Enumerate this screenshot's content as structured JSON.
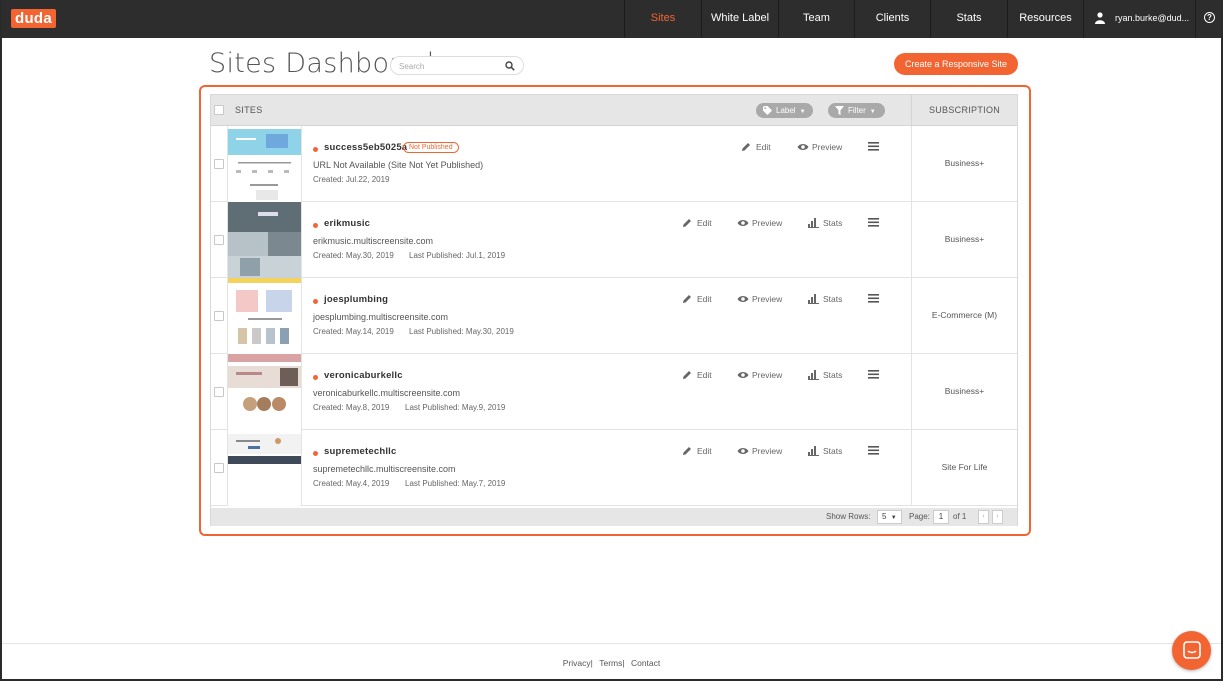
{
  "brand": {
    "logo": "duda",
    "accent": "#f26533"
  },
  "nav": {
    "items": [
      {
        "label": "Sites",
        "active": true
      },
      {
        "label": "White Label",
        "active": false
      },
      {
        "label": "Team",
        "active": false
      },
      {
        "label": "Clients",
        "active": false
      },
      {
        "label": "Stats",
        "active": false
      },
      {
        "label": "Resources",
        "active": false
      }
    ],
    "user": "ryan.burke@dud...",
    "help_icon": "?"
  },
  "header": {
    "title": "Sites Dashboard",
    "search_placeholder": "Search",
    "create_button": "Create a Responsive Site"
  },
  "table": {
    "col_sites": "SITES",
    "label_filter": "Label",
    "filter": "Filter",
    "col_subscription": "SUBSCRIPTION",
    "actions": {
      "edit": "Edit",
      "preview": "Preview",
      "stats": "Stats"
    },
    "rows": [
      {
        "name": "success5eb5025a",
        "badge": "Not Published",
        "url": "URL Not Available (Site Not Yet Published)",
        "created": "Created: Jul.22, 2019",
        "published": "",
        "subscription": "Business+",
        "has_stats": false
      },
      {
        "name": "erikmusic",
        "badge": "",
        "url": "erikmusic.multiscreensite.com",
        "created": "Created: May.30, 2019",
        "published": "Last Published: Jul.1, 2019",
        "subscription": "Business+",
        "has_stats": true
      },
      {
        "name": "joesplumbing",
        "badge": "",
        "url": "joesplumbing.multiscreensite.com",
        "created": "Created: May.14, 2019",
        "published": "Last Published: May.30, 2019",
        "subscription": "E-Commerce (M)",
        "has_stats": true
      },
      {
        "name": "veronicaburkellc",
        "badge": "",
        "url": "veronicaburkellc.multiscreensite.com",
        "created": "Created: May.8, 2019",
        "published": "Last Published: May.9, 2019",
        "subscription": "Business+",
        "has_stats": true
      },
      {
        "name": "supremetechllc",
        "badge": "",
        "url": "supremetechllc.multiscreensite.com",
        "created": "Created: May.4, 2019",
        "published": "Last Published: May.7, 2019",
        "subscription": "Site For Life",
        "has_stats": true
      }
    ],
    "footer": {
      "show_rows_label": "Show Rows:",
      "rows_value": "5",
      "page_label": "Page:",
      "page_value": "1",
      "of_label": "of 1",
      "prev": "‹",
      "next": "›"
    }
  },
  "footer": {
    "privacy": "Privacy",
    "terms": "Terms",
    "contact": "Contact",
    "sep": "|"
  }
}
